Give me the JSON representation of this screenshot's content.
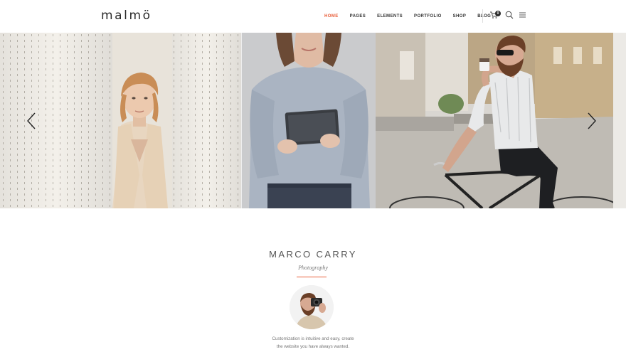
{
  "brand": {
    "logo_text": "malmö",
    "accent_color": "#e9603c"
  },
  "nav": {
    "items": [
      {
        "label": "HOME",
        "active": true
      },
      {
        "label": "PAGES",
        "active": false
      },
      {
        "label": "ELEMENTS",
        "active": false
      },
      {
        "label": "PORTFOLIO",
        "active": false
      },
      {
        "label": "SHOP",
        "active": false
      },
      {
        "label": "BLOG",
        "active": false
      }
    ],
    "cart_count": "0",
    "icons": [
      "cart-icon",
      "search-icon",
      "menu-icon"
    ]
  },
  "slider": {
    "slides": [
      {
        "subject": "woman-curtains"
      },
      {
        "subject": "woman-tablet"
      },
      {
        "subject": "man-bicycle"
      }
    ],
    "prev_icon": "chevron-left-icon",
    "next_icon": "chevron-right-icon"
  },
  "about": {
    "name": "MARCO CARRY",
    "role": "Photography",
    "text_line1": "Customization is intuitive and easy, create",
    "text_line2": "the website you have always wanted."
  }
}
